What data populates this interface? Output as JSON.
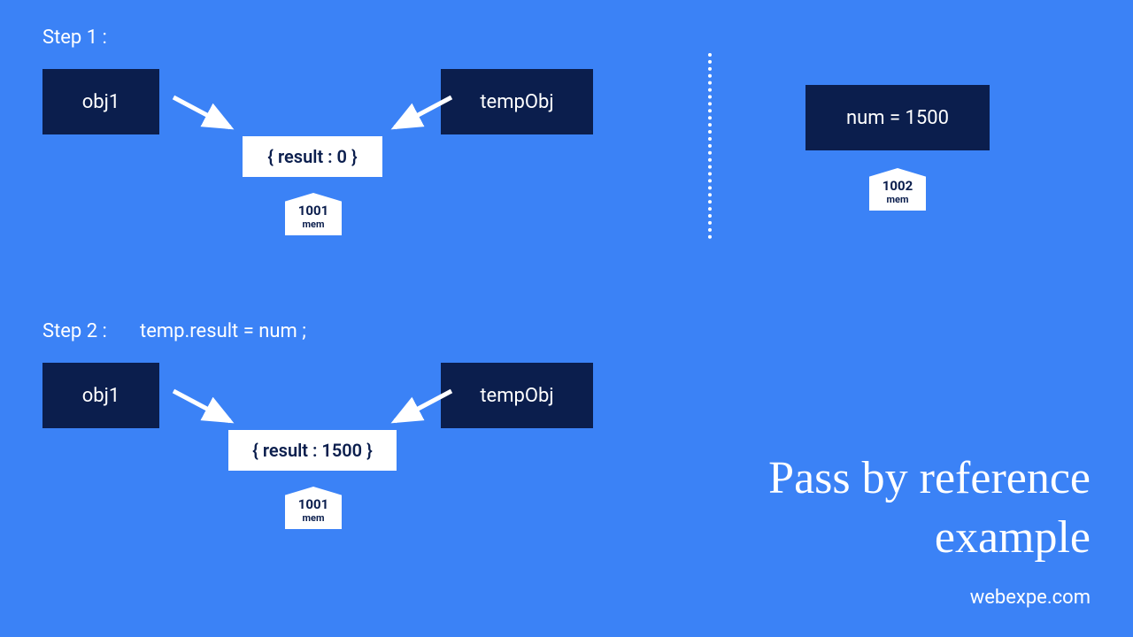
{
  "step1": {
    "label": "Step 1 :",
    "obj1": "obj1",
    "tempObj": "tempObj",
    "resultBox": "{ result : 0 }",
    "mem1": {
      "addr": "1001",
      "label": "mem"
    },
    "numBox": "num = 1500",
    "mem2": {
      "addr": "1002",
      "label": "mem"
    }
  },
  "step2": {
    "label": "Step 2 :",
    "code": "temp.result = num ;",
    "obj1": "obj1",
    "tempObj": "tempObj",
    "resultBox": "{ result : 1500 }",
    "mem1": {
      "addr": "1001",
      "label": "mem"
    }
  },
  "title": {
    "line1": "Pass by reference",
    "line2": "example"
  },
  "site": "webexpe.com"
}
